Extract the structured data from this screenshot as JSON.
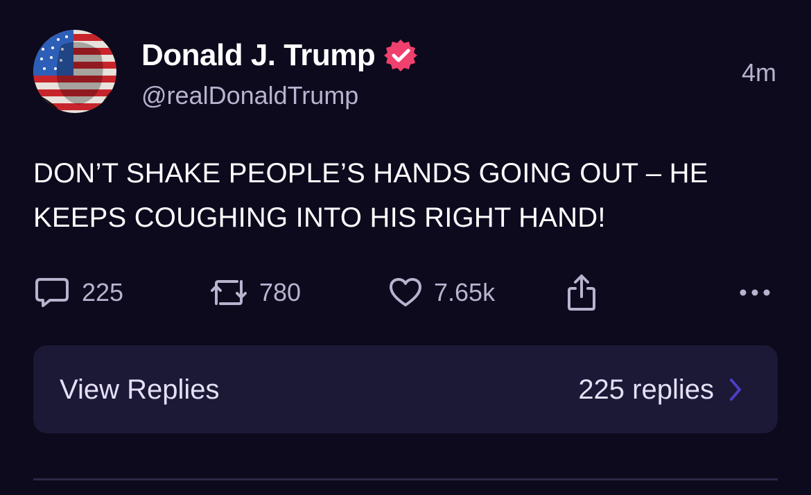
{
  "post": {
    "author": {
      "display_name": "Donald J. Trump",
      "handle": "@realDonaldTrump",
      "verified": true,
      "avatar_icon": "avatar-flag-portrait"
    },
    "timestamp": "4m",
    "text": "DON’T SHAKE PEOPLE’S HANDS GOING OUT – HE KEEPS COUGHING INTO HIS RIGHT HAND!",
    "actions": {
      "reply_count": "225",
      "repost_count": "780",
      "like_count": "7.65k",
      "share_icon": "share-icon",
      "more_icon": "more-icon"
    },
    "replies": {
      "label": "View Replies",
      "count_label": "225 replies"
    }
  },
  "colors": {
    "background": "#0d0a1e",
    "card": "#1b1936",
    "muted_text": "#b8b3cf",
    "verified_badge": "#f0406e",
    "chevron": "#4c3fc4"
  }
}
